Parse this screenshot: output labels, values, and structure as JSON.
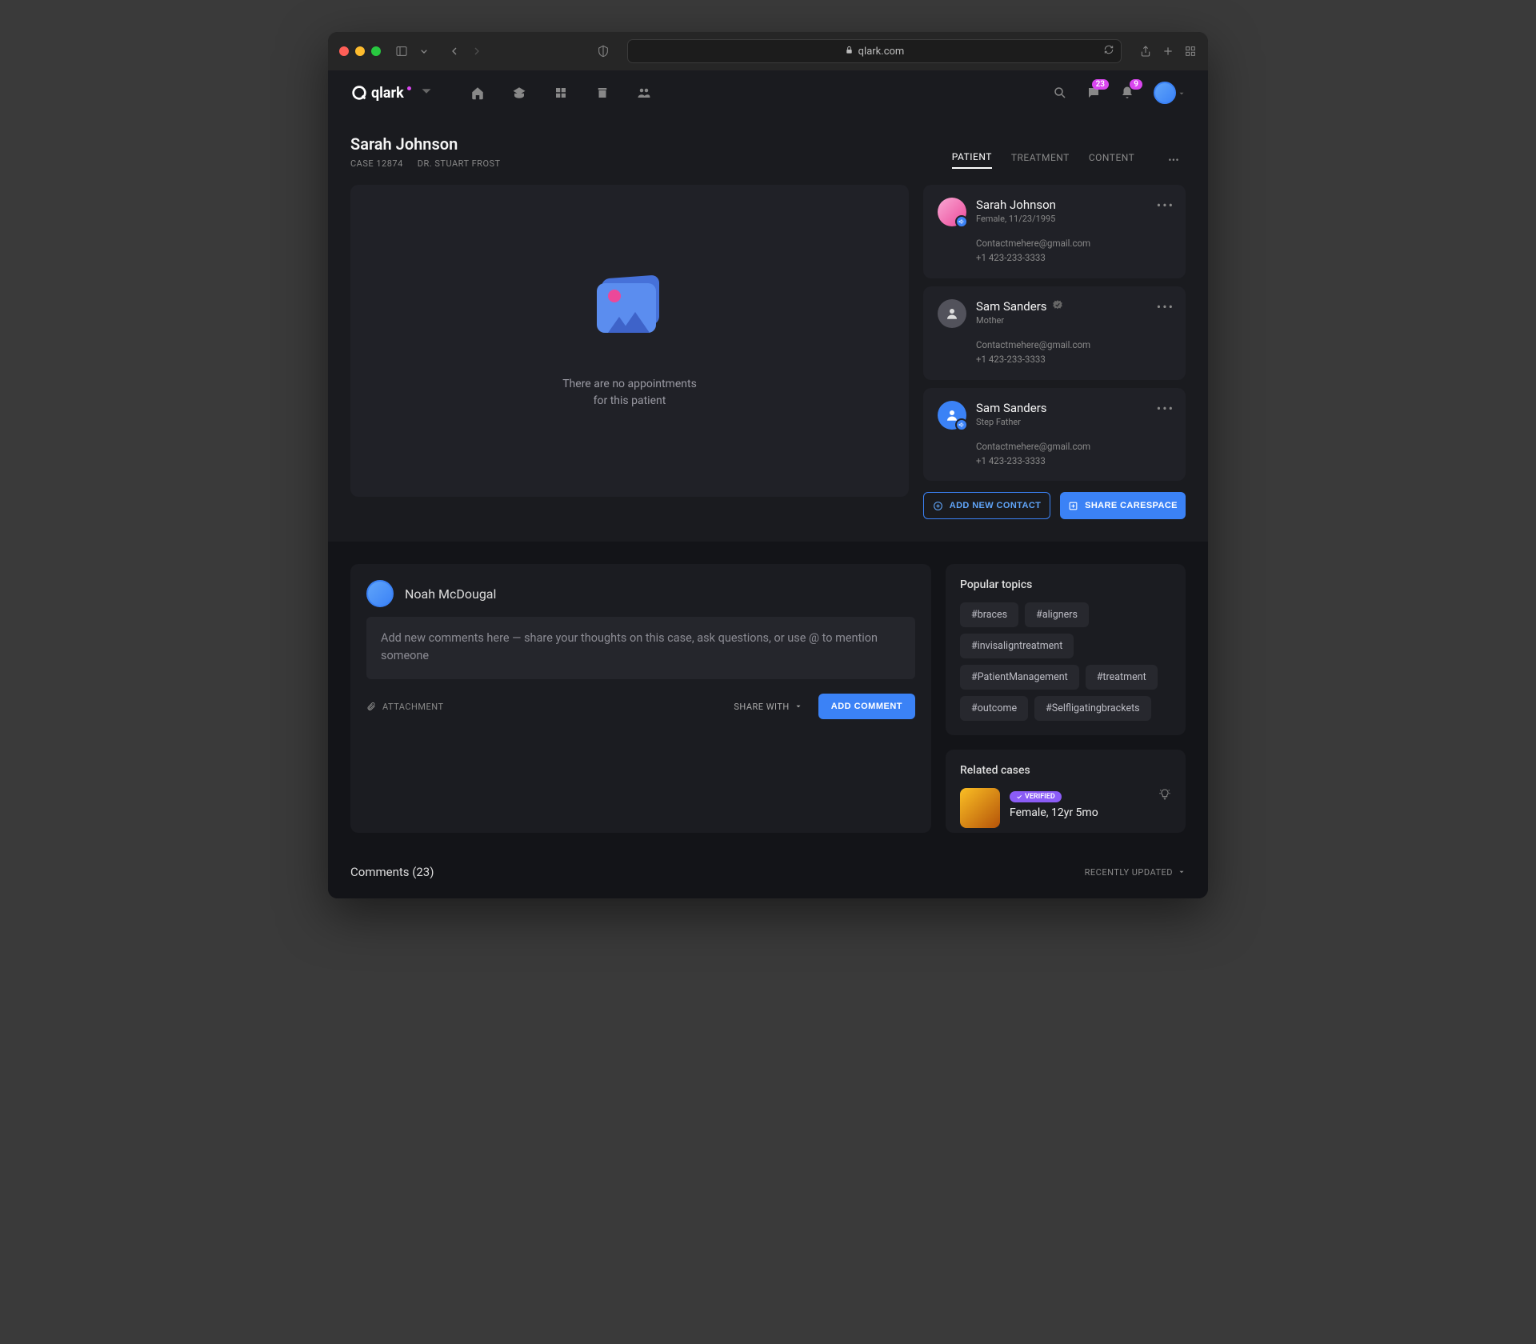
{
  "browser": {
    "url": "qlark.com"
  },
  "logo_text": "qlark",
  "header": {
    "msg_badge": "23",
    "notif_badge": "9"
  },
  "patient": {
    "name": "Sarah Johnson",
    "case_label": "CASE 12874",
    "doctor": "DR. STUART FROST"
  },
  "tabs": {
    "patient": "PATIENT",
    "treatment": "TREATMENT",
    "content": "CONTENT"
  },
  "empty": {
    "line1": "There are no appointments",
    "line2": "for this patient"
  },
  "contacts": [
    {
      "name": "Sarah Johnson",
      "sub": "Female, 11/23/1995",
      "email": "Contactmehere@gmail.com",
      "phone": "+1 423-233-3333"
    },
    {
      "name": "Sam Sanders",
      "sub": "Mother",
      "email": "Contactmehere@gmail.com",
      "phone": "+1 423-233-3333"
    },
    {
      "name": "Sam Sanders",
      "sub": "Step Father",
      "email": "Contactmehere@gmail.com",
      "phone": "+1 423-233-3333"
    }
  ],
  "buttons": {
    "add_contact": "ADD NEW CONTACT",
    "share_carespace": "SHARE CARESPACE"
  },
  "compose": {
    "author": "Noah McDougal",
    "placeholder": "Add new comments here — share your thoughts on this case, ask questions, or use @ to mention someone",
    "attachment": "ATTACHMENT",
    "share_with": "SHARE WITH",
    "add_comment": "ADD COMMENT"
  },
  "topics": {
    "title": "Popular topics",
    "tags": [
      "#braces",
      "#aligners",
      "#invisaligntreatment",
      "#PatientManagement",
      "#treatment",
      "#outcome",
      "#Selfligatingbrackets"
    ]
  },
  "related": {
    "title": "Related cases",
    "verified": "VERIFIED",
    "case_title": "Female, 12yr 5mo"
  },
  "comments": {
    "label": "Comments (23)",
    "sort": "RECENTLY UPDATED"
  }
}
